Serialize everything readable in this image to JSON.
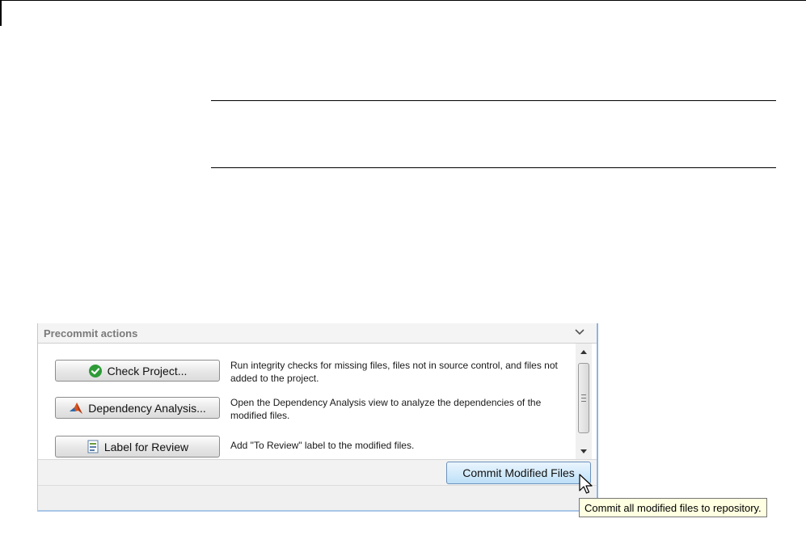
{
  "panel": {
    "title": "Precommit actions",
    "collapse_icon": "chevron-down-icon"
  },
  "actions": [
    {
      "label": "Check Project...",
      "icon": "green-check-icon",
      "description": "Run integrity checks for missing files, files not in source control, and files not added to the project."
    },
    {
      "label": "Dependency Analysis...",
      "icon": "matlab-logo-icon",
      "description": "Open the Dependency Analysis view to analyze the dependencies of the modified files."
    },
    {
      "label": "Label for Review",
      "icon": "label-icon",
      "description": "Add \"To Review\" label to the modified files."
    }
  ],
  "commit": {
    "label": "Commit Modified Files",
    "tooltip": "Commit all modified files to repository."
  },
  "colors": {
    "tooltip_bg": "#ffffe1",
    "commit_button": "#d4ebfb",
    "check_green": "#2e9b38"
  }
}
